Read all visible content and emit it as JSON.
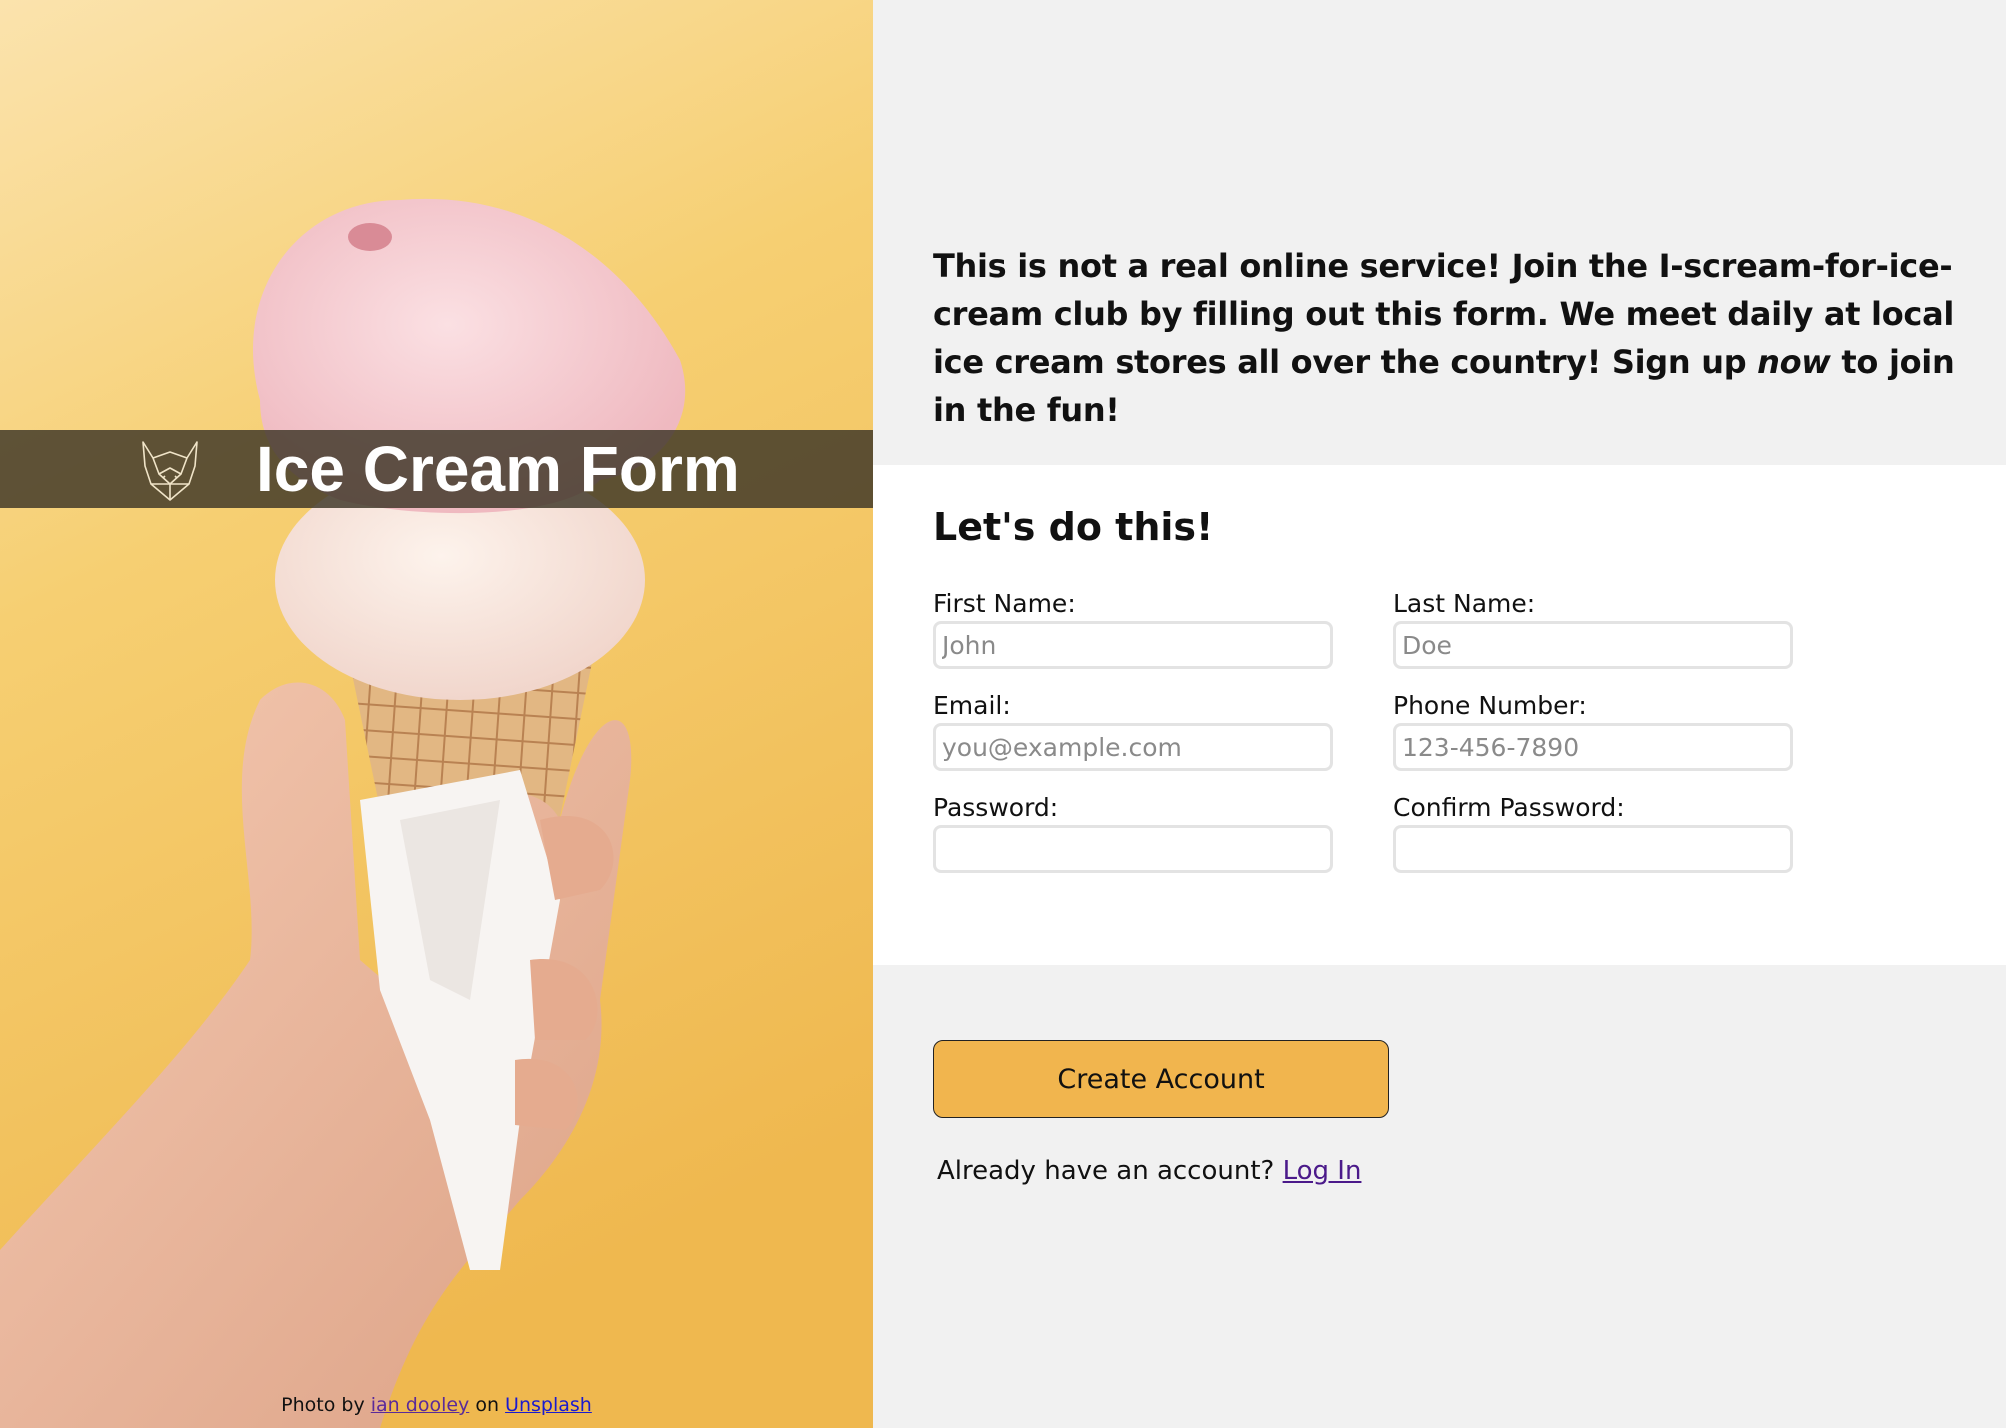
{
  "brand": {
    "title": "Ice Cream Form",
    "logo_icon": "wolf-logo-icon"
  },
  "photo_credit": {
    "prefix": "Photo by",
    "author": "ian dooley",
    "middle": "on",
    "site": "Unsplash"
  },
  "intro": {
    "text_before": "This is not a real online service! Join the I-scream-for-ice-cream club by filling out this form. We meet daily at local ice cream stores all over the country! Sign up ",
    "emphasis": "now",
    "text_after": " to join in the fun!"
  },
  "form": {
    "heading": "Let's do this!",
    "fields": {
      "first_name": {
        "label": "First Name:",
        "placeholder": "John",
        "value": ""
      },
      "last_name": {
        "label": "Last Name:",
        "placeholder": "Doe",
        "value": ""
      },
      "email": {
        "label": "Email:",
        "placeholder": "you@example.com",
        "value": ""
      },
      "phone": {
        "label": "Phone Number:",
        "placeholder": "123-456-7890",
        "value": ""
      },
      "password": {
        "label": "Password:",
        "placeholder": "",
        "value": ""
      },
      "confirm_password": {
        "label": "Confirm Password:",
        "placeholder": "",
        "value": ""
      }
    }
  },
  "actions": {
    "create_label": "Create Account",
    "login_prompt": "Already have an account?",
    "login_link": "Log In"
  },
  "colors": {
    "accent": "#f1b54e",
    "panel_background": "#f1f1f1",
    "form_background": "#ffffff",
    "brand_bar": "#3c3426",
    "link": "#4b1a8a"
  }
}
